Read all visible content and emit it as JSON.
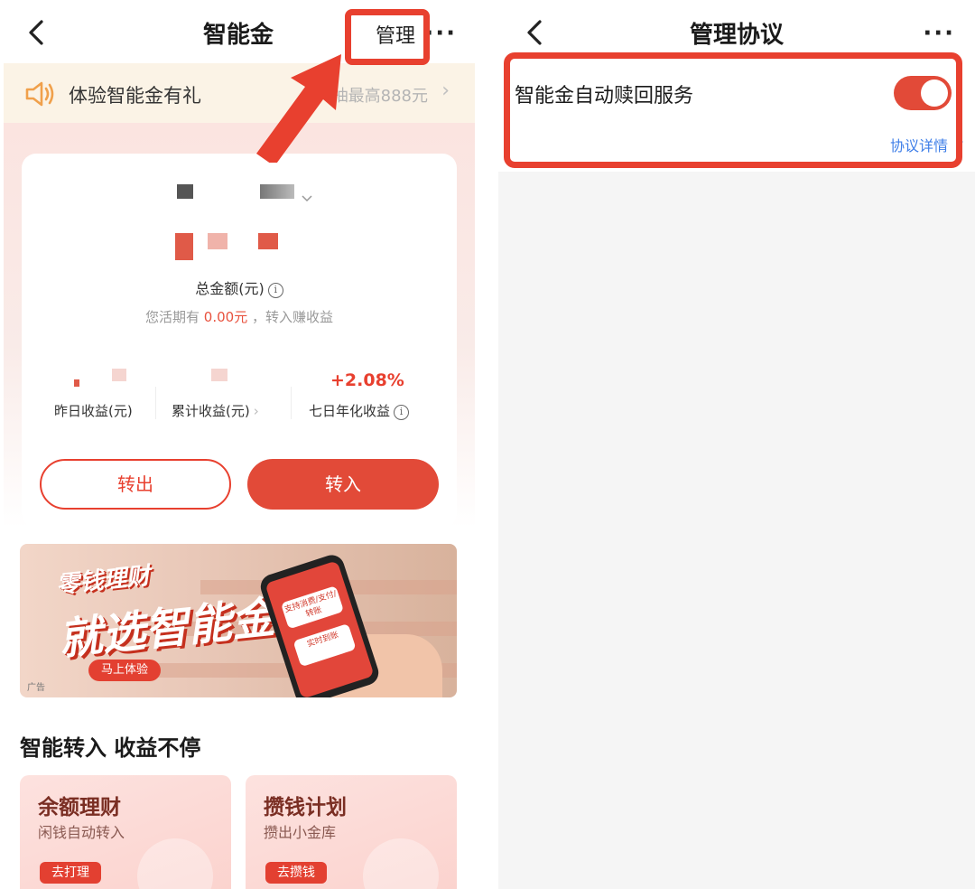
{
  "left": {
    "nav": {
      "title": "智能金",
      "manage": "管理",
      "more": "···"
    },
    "promo": {
      "text": "体验智能金有礼",
      "right": "抽最高888元"
    },
    "card": {
      "total_label": "总金额(元)",
      "hint_prefix": "您活期有",
      "hint_amount": "0.00元",
      "hint_suffix": "，转入赚收益",
      "stats": [
        {
          "label": "昨日收益(元)",
          "value": ""
        },
        {
          "label": "累计收益(元)",
          "value": ""
        },
        {
          "label": "七日年化收益",
          "value": "+2.08%"
        }
      ],
      "btn_out": "转出",
      "btn_in": "转入"
    },
    "banner": {
      "line1": "零钱理财",
      "line2": "就选智能金",
      "cta": "马上体验",
      "ad": "广告",
      "phone_pill1": "支持消费/支付/转账",
      "phone_pill2": "实时到账"
    },
    "section_title": "智能转入 收益不停",
    "features": [
      {
        "title": "余额理财",
        "sub": "闲钱自动转入",
        "btn": "去打理"
      },
      {
        "title": "攒钱计划",
        "sub": "攒出小金库",
        "btn": "去攒钱"
      }
    ]
  },
  "right": {
    "nav": {
      "title": "管理协议",
      "more": "···"
    },
    "service": {
      "label": "智能金自动赎回服务",
      "toggle_on": true,
      "detail": "协议详情"
    }
  },
  "colors": {
    "accent": "#e24a38",
    "highlight": "#e8402f",
    "link": "#3f7fe8"
  }
}
